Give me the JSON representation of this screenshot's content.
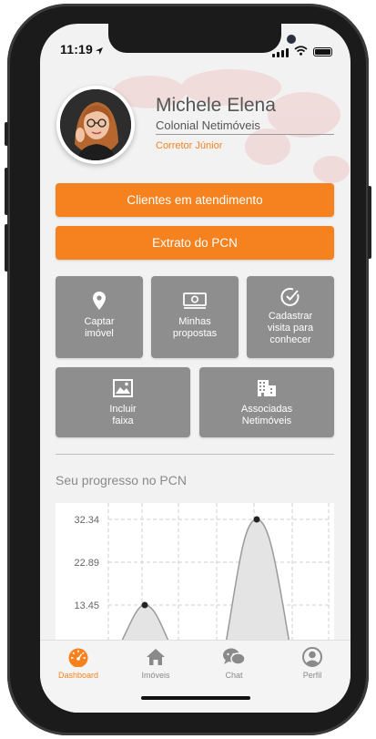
{
  "status_bar": {
    "time": "11:19"
  },
  "profile": {
    "name": "Michele Elena",
    "company": "Colonial Netimóveis",
    "role": "Corretor Júnior"
  },
  "actions": {
    "clients_label": "Clientes em atendimento",
    "statement_label": "Extrato do PCN"
  },
  "tiles": [
    {
      "label": "Captar\nimóvel",
      "icon": "location-pin-icon"
    },
    {
      "label": "Minhas\npropostas",
      "icon": "money-icon"
    },
    {
      "label": "Cadastrar\nvisita para\nconhecer",
      "icon": "check-circle-icon"
    },
    {
      "label": "Incluir\nfaixa",
      "icon": "image-icon"
    },
    {
      "label": "Associadas\nNetimóveis",
      "icon": "building-icon"
    }
  ],
  "progress": {
    "title": "Seu progresso no PCN"
  },
  "chart_data": {
    "type": "area",
    "title": "",
    "xlabel": "",
    "ylabel": "",
    "y_ticks": [
      "32.34",
      "22.89",
      "13.45"
    ],
    "ylim": [
      0,
      40
    ],
    "peaks": [
      13.45,
      32.34
    ],
    "grid": true,
    "color": "#555555",
    "fill": "#e4e4e4"
  },
  "tabbar": {
    "items": [
      {
        "label": "Dashboard",
        "icon": "dashboard-gauge-icon",
        "active": true
      },
      {
        "label": "Imóveis",
        "icon": "house-icon",
        "active": false
      },
      {
        "label": "Chat",
        "icon": "chat-bubbles-icon",
        "active": false
      },
      {
        "label": "Perfil",
        "icon": "user-profile-icon",
        "active": false
      }
    ]
  },
  "colors": {
    "accent": "#f5821f",
    "tile": "#8e8e8e",
    "background": "#f2f2f2"
  }
}
